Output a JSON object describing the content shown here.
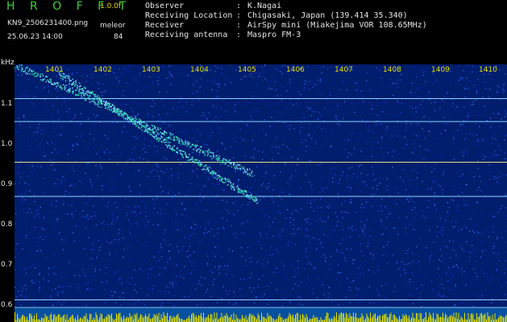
{
  "header": {
    "brand": "H R O F F T",
    "version": "1.0.0f",
    "filename": "KN9_2506231400.png",
    "datetime": "25.06.23 14:00",
    "mode": "meleor",
    "number": "84",
    "info": [
      {
        "key": "Observer",
        "value": "K.Nagai"
      },
      {
        "key": "Receiving Location",
        "value": "Chigasaki, Japan (139.414 35.340)"
      },
      {
        "key": "Receiver",
        "value": "AirSpy mini (Miakejima VOR 108.65MHz)"
      },
      {
        "key": "Receiving antenna",
        "value": "Maspro FM-3"
      }
    ]
  },
  "axis": {
    "unit": "kHz",
    "y_ticks": [
      "1.1",
      "1.0",
      "0.9",
      "0.8",
      "0.7",
      "0.6"
    ],
    "x_ticks": [
      "1401",
      "1402",
      "1403",
      "1404",
      "1405",
      "1406",
      "1407",
      "1408",
      "1409",
      "1410"
    ]
  },
  "colors": {
    "background": "#001d6e",
    "noise": "#1f5bff",
    "line": "#8fd8ff",
    "trace": "#2fe9b0",
    "label": "#e5e000"
  },
  "spectrogram": {
    "horizontal_lines_khz": [
      1.115,
      1.058,
      0.957,
      0.872,
      0.615,
      0.596
    ],
    "traces": [
      {
        "from_khz": 1.2,
        "to_khz": 0.93,
        "x_start": 1400.3,
        "x_end": 1405.2
      },
      {
        "from_khz": 1.18,
        "to_khz": 0.86,
        "x_start": 1401.2,
        "x_end": 1405.3
      }
    ]
  }
}
